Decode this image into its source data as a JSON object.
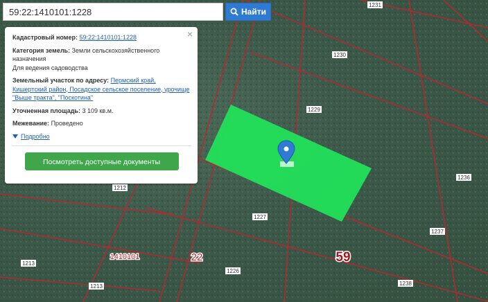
{
  "search": {
    "value": "59:22:1410101:1228",
    "button_label": "Найти"
  },
  "popup": {
    "cadastral_label": "Кадастровый номер:",
    "cadastral_value": "59:22:1410101:1228",
    "category_label": "Категория земель:",
    "category_value": "Земли сельскохозяйственного назначения",
    "usage": "Для ведения садоводства",
    "address_label": "Земельный участок по адресу:",
    "address_value": "Пермский край, Кишертский район, Посадское сельское поселение, урочище \"Выше тракта\", \"Поскотина\"",
    "area_label": "Уточненная площадь:",
    "area_value": "3 109 кв.м.",
    "survey_label": "Межевание:",
    "survey_value": "Проведено",
    "more_label": "Подробно",
    "docs_button": "Посмотреть доступные документы",
    "close_symbol": "×"
  },
  "map": {
    "parcel_labels": [
      "1231",
      "1230",
      "1229",
      "1236",
      "1237",
      "1238",
      "1227",
      "1226",
      "1212",
      "1213",
      "1213"
    ],
    "quarter_label": "1410101",
    "district_label": "22",
    "region_label": "59",
    "highlight_color": "#22e05a",
    "boundary_color": "#c8202a",
    "marker_color": "#2f7bd4",
    "marker_icon": "map-pin-icon"
  },
  "colors": {
    "search_button": "#2f7bd4",
    "docs_button": "#3fa64b",
    "link": "#1f5fb0"
  }
}
